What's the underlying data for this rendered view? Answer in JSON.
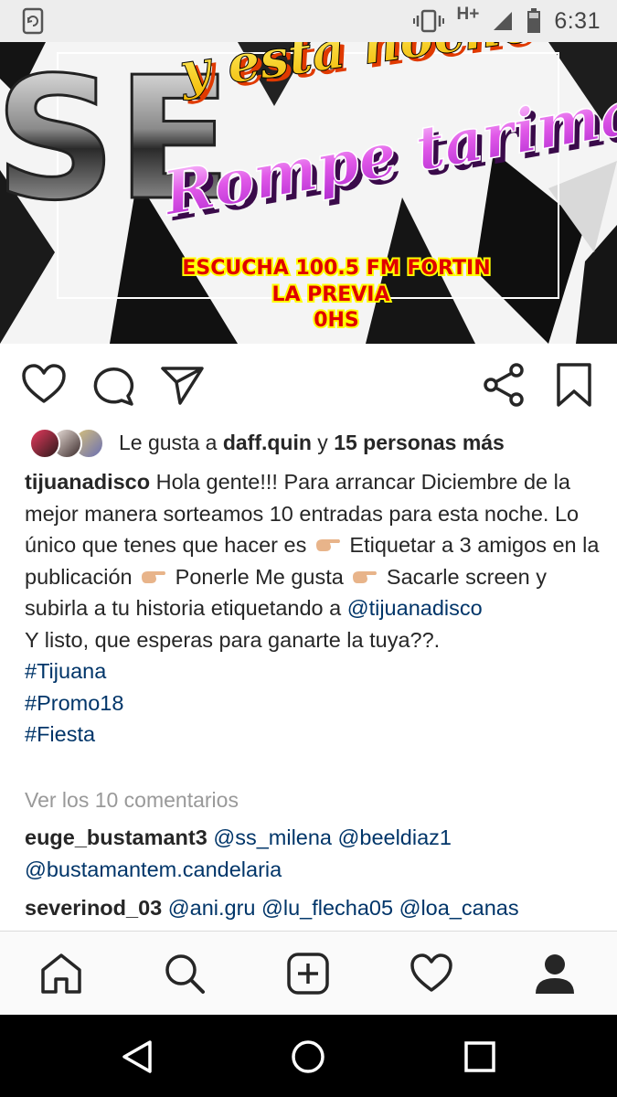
{
  "status_bar": {
    "network": "H+",
    "time": "6:31"
  },
  "post_image": {
    "line1": "y esta noche",
    "line2": "Rompe tarima",
    "line3": "ESCUCHA 100.5 FM FORTIN",
    "line4": "LA PREVIA",
    "line5": "0HS",
    "side_letters": "SE"
  },
  "likes": {
    "prefix": "Le gusta a",
    "user": "daff.quin",
    "connector": "y",
    "others": "15 personas más"
  },
  "caption": {
    "username": "tijuanadisco",
    "text_1": "Hola gente!!! Para arrancar Diciembre de la mejor manera sorteamos 10 entradas para esta noche. Lo único que tenes que hacer es",
    "text_2": "Etiquetar a 3 amigos en la publicación",
    "text_3": "Ponerle Me gusta",
    "text_4": "Sacarle screen y subirla a tu historia etiquetando a",
    "mention": "@tijuanadisco",
    "text_5": "Y listo, que esperas para ganarte la tuya??.",
    "hashtags": [
      "#Tijuana",
      "#Promo18",
      "#Fiesta"
    ]
  },
  "view_comments": "Ver los 10 comentarios",
  "comments": [
    {
      "user": "euge_bustamant3",
      "mentions": "@ss_milena @beeldiaz1 @bustamantem.candelaria"
    },
    {
      "user": "severinod_03",
      "mentions": "@ani.gru @lu_flecha05 @loa_canas"
    }
  ],
  "icons": {
    "like": "heart-icon",
    "comment": "comment-icon",
    "share": "send-icon",
    "share_alt": "share-icon",
    "save": "bookmark-icon",
    "home": "home-icon",
    "search": "search-icon",
    "add": "add-post-icon",
    "activity": "heart-icon",
    "profile": "profile-icon"
  },
  "colors": {
    "link": "#003569",
    "muted": "#999999",
    "text": "#262626"
  }
}
